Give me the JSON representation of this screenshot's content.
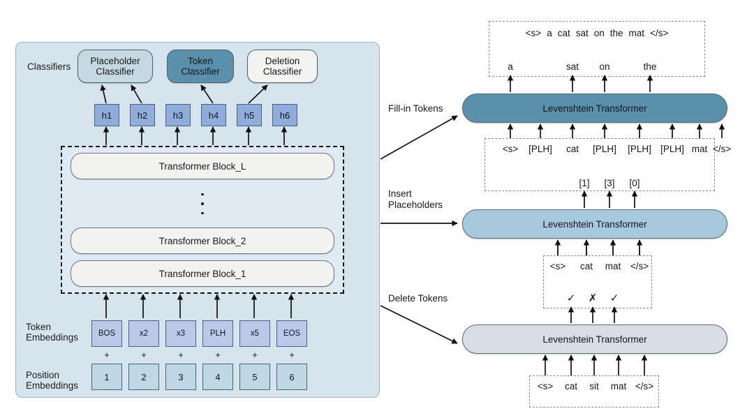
{
  "left_panel": {
    "classifiers_label": "Classifiers",
    "classifiers": [
      {
        "id": "placeholder",
        "line1": "Placeholder",
        "line2": "Classifier",
        "fill": "#c5d9e3"
      },
      {
        "id": "token",
        "line1": "Token",
        "line2": "Classifier",
        "fill": "#5a90ab"
      },
      {
        "id": "deletion",
        "line1": "Deletion",
        "line2": "Classifier",
        "fill": "#f3f3f1"
      }
    ],
    "hidden_states": [
      "h1",
      "h2",
      "h3",
      "h4",
      "h5",
      "h6"
    ],
    "transformer_blocks": [
      "Transformer Block_L",
      "Transformer Block_2",
      "Transformer Block_1"
    ],
    "token_embeddings_label": "Token\nEmbeddings",
    "position_embeddings_label": "Position\nEmbeddings",
    "token_embeddings": [
      "BOS",
      "x2",
      "x3",
      "PLH",
      "x5",
      "EOS"
    ],
    "plus_signs": [
      "+",
      "+",
      "+",
      "+",
      "+",
      "+"
    ],
    "position_embeddings": [
      "1",
      "2",
      "3",
      "4",
      "5",
      "6"
    ]
  },
  "stage_labels": {
    "fill_in": "Fill-in Tokens",
    "insert": "Insert\nPlaceholders",
    "delete": "Delete Tokens"
  },
  "right_flow": {
    "top": {
      "final_output": [
        "<s>",
        "a",
        "cat",
        "sat",
        "on",
        "the",
        "mat",
        "</s>"
      ],
      "predicted_tokens": [
        "a",
        "sat",
        "on",
        "the"
      ],
      "predicted_columns": [
        1,
        3,
        4,
        5
      ],
      "transformer_label": "Levenshtein Transformer",
      "transformer_fill": "#5a90ab",
      "input_tokens": [
        "<s>",
        "[PLH]",
        "cat",
        "[PLH]",
        "[PLH]",
        "[PLH]",
        "mat",
        "</s>"
      ]
    },
    "middle": {
      "placeholder_counts": [
        "[1]",
        "[3]",
        "[0]"
      ],
      "transformer_label": "Levenshtein Transformer",
      "transformer_fill": "#a8c8de",
      "input_tokens": [
        "<s>",
        "cat",
        "mat",
        "</s>"
      ]
    },
    "bottom": {
      "decisions": [
        "✓",
        "✗",
        "✓"
      ],
      "transformer_label": "Levenshtein Transformer",
      "transformer_fill": "#d9dde6",
      "input_tokens": [
        "<s>",
        "cat",
        "sit",
        "mat",
        "</s>"
      ]
    }
  },
  "colors": {
    "panel_bg": "#d6e4ee",
    "hidden_state_fill": "#8fadda",
    "token_embed_fill": "#bcc8e8",
    "position_embed_fill": "#bfd8e5",
    "block_fill": "#f2f2f0",
    "arrow": "#111111",
    "dashed": "#8d8d8d"
  }
}
